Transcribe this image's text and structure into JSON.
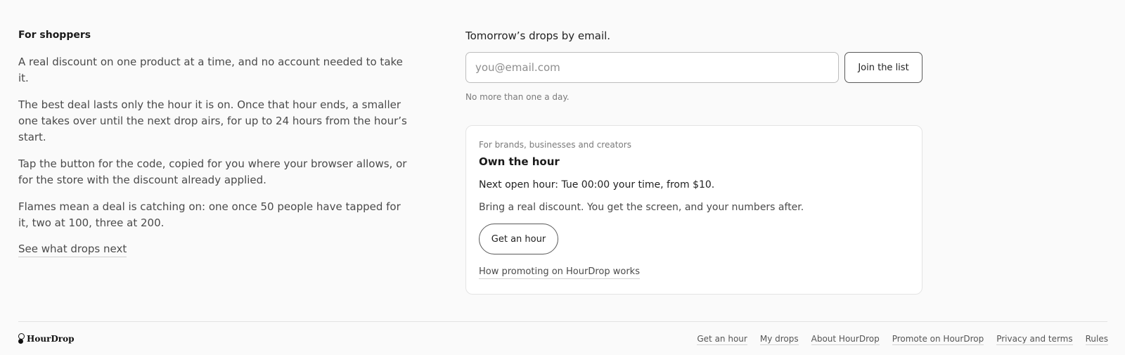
{
  "shoppers": {
    "title": "For shoppers",
    "paragraphs": [
      "A real discount on one product at a time, and no account needed to take it.",
      "The best deal lasts only the hour it is on. Once that hour ends, a smaller one takes over until the next drop airs, for up to 24 hours from the hour’s start.",
      "Tap the button for the code, copied for you where your browser allows, or for the store with the discount already applied.",
      "Flames mean a deal is catching on: one once 50 people have tapped for it, two at 100, three at 200."
    ],
    "link": "See what drops next"
  },
  "signup": {
    "heading": "Tomorrow’s drops by email.",
    "email_value": "",
    "email_placeholder": "you@email.com",
    "button": "Join the list",
    "note": "No more than one a day."
  },
  "brands": {
    "kicker": "For brands, businesses and creators",
    "title": "Own the hour",
    "next_hour": "Next open hour: Tue 00:00 your time, from $10.",
    "pitch": "Bring a real discount. You get the screen, and your numbers after.",
    "button": "Get an hour",
    "link": "How promoting on HourDrop works"
  },
  "footer": {
    "logo": "HourDrop",
    "links": [
      "Get an hour",
      "My drops",
      "About HourDrop",
      "Promote on HourDrop",
      "Privacy and terms",
      "Rules"
    ]
  }
}
